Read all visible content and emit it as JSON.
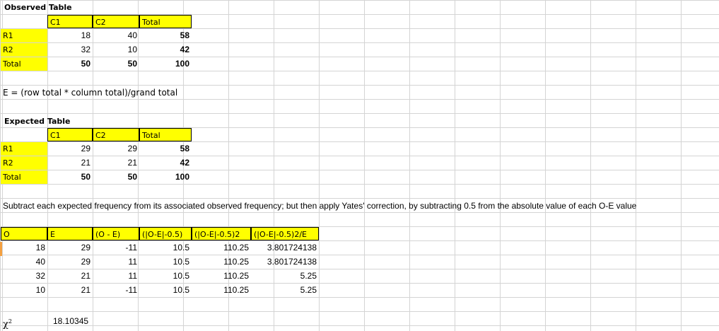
{
  "observed": {
    "title": "Observed Table",
    "col_headers": [
      "C1",
      "C2",
      "Total"
    ],
    "rows": [
      {
        "label": "R1",
        "values": [
          "18",
          "40",
          "58"
        ]
      },
      {
        "label": "R2",
        "values": [
          "32",
          "10",
          "42"
        ]
      },
      {
        "label": "Total",
        "values": [
          "50",
          "50",
          "100"
        ]
      }
    ]
  },
  "formula_note": "E = (row total * column total)/grand total",
  "expected": {
    "title": "Expected Table",
    "col_headers": [
      "C1",
      "C2",
      "Total"
    ],
    "rows": [
      {
        "label": "R1",
        "values": [
          "29",
          "29",
          "58"
        ]
      },
      {
        "label": "R2",
        "values": [
          "21",
          "21",
          "42"
        ]
      },
      {
        "label": "Total",
        "values": [
          "50",
          "50",
          "100"
        ]
      }
    ]
  },
  "instruction": "Subtract each expected frequency from its associated observed frequency; but then apply Yates' correction, by subtracting 0.5 from the absolute value of each O-E value",
  "calc": {
    "headers": [
      "O",
      "E",
      "(O - E)",
      "(|O-E|-0.5)",
      "(|O-E|-0.5)2",
      "(|O-E|-0.5)2/E"
    ],
    "rows": [
      [
        "18",
        "29",
        "-11",
        "10.5",
        "110.25",
        "3.801724138"
      ],
      [
        "40",
        "29",
        "11",
        "10.5",
        "110.25",
        "3.801724138"
      ],
      [
        "32",
        "21",
        "11",
        "10.5",
        "110.25",
        "5.25"
      ],
      [
        "10",
        "21",
        "-11",
        "10.5",
        "110.25",
        "5.25"
      ]
    ]
  },
  "chi": {
    "symbol": "χ",
    "superscript": "2",
    "value": "18.10345"
  },
  "colors": {
    "header_fill": "#ffff00",
    "gridline": "#d4d4d4",
    "active_row_marker": "#f4a040"
  }
}
